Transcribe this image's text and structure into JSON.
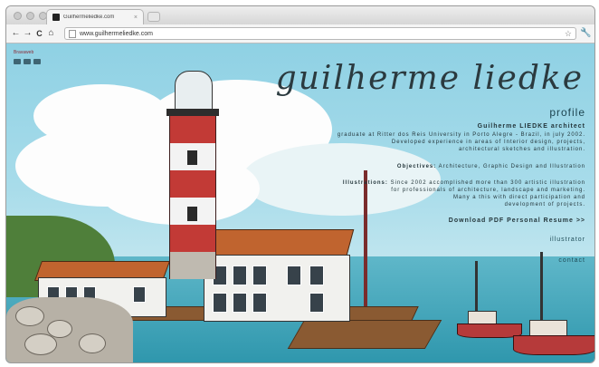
{
  "browser": {
    "tab_title": "Guilhermeliedke.com",
    "url": "www.guilhermeliedke.com",
    "nav": {
      "back": "←",
      "forward": "→",
      "reload": "C",
      "home": "⌂"
    }
  },
  "site": {
    "logo": "guilherme liedke",
    "section": "profile",
    "person_heading": "Guilherme LIEDKE architect",
    "bio": [
      "graduate at Ritter dos Reis University in Porto Alegre - Brazil, in july 2002.",
      "Developed experience in areas of Interior design, projects,",
      "architectural sketches and illustration."
    ],
    "objectives_label": "Objectives:",
    "objectives_text": "Architecture, Graphic Design and Illustration",
    "illustrations_label": "Illustrations:",
    "illustrations_text": [
      "Since 2002 accomplished more than 300 artistic illustration",
      "for professionals of architecture, landscape and marketing.",
      "Many a this with direct participation and",
      "development of projects."
    ],
    "download": "Download PDF Personal Resume >>",
    "links": [
      "illustrator",
      "contact"
    ],
    "social_label": "Bravaweb",
    "social_icons": [
      "facebook-icon",
      "twitter-icon",
      "rss-icon"
    ]
  },
  "colors": {
    "sky": "#8fd1e4",
    "sea": "#2f97ad",
    "lighthouse_red": "#c23a36",
    "text": "#24363b"
  }
}
